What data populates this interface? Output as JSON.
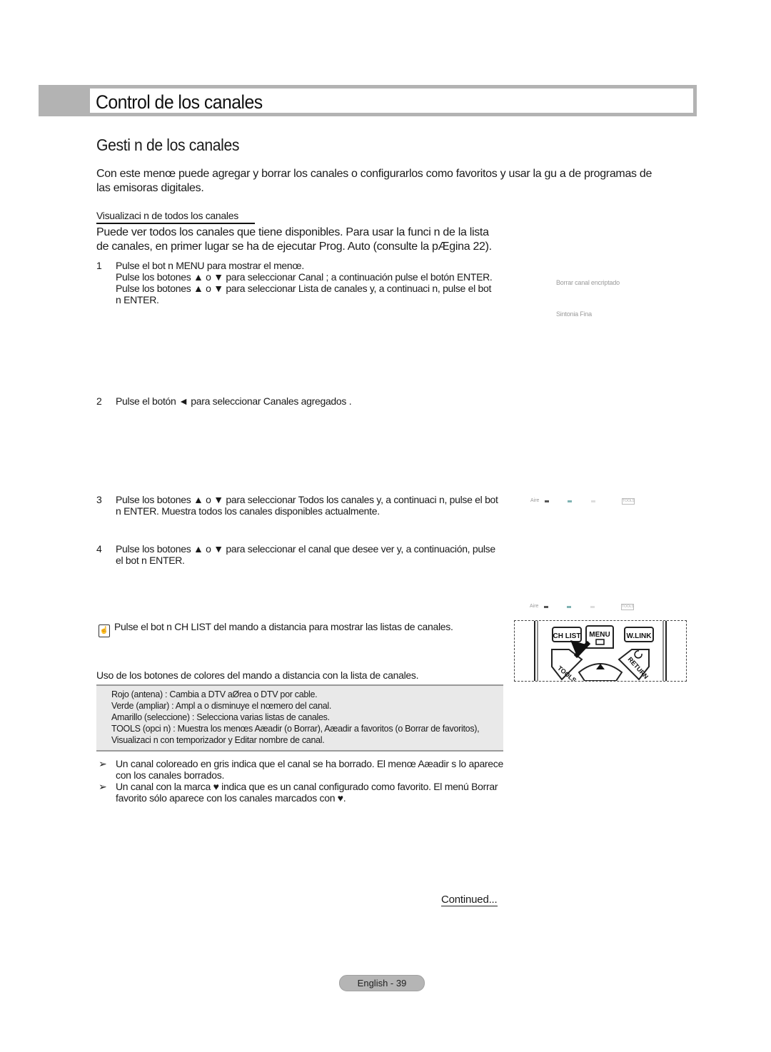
{
  "header": {
    "title": "Control de los canales"
  },
  "section": {
    "title": "Gesti n de los canales",
    "intro": "Con este menœ puede agregar y borrar los canales o configurarlos como favoritos y usar la gu a de programas de las emisoras digitales."
  },
  "subsection": {
    "heading": "Visualizaci n de todos los canales",
    "intro": "Puede ver todos los canales que tiene disponibles. Para usar la funci n de la lista de canales, en primer lugar se ha de ejecutar Prog. Auto (consulte la pÆgina 22)."
  },
  "steps": [
    {
      "number": "1",
      "lines": [
        "Pulse el bot n  MENU para mostrar el menœ.",
        "Pulse los botones ▲ o ▼ para seleccionar Canal ; a continuación pulse el botón ENTER.",
        "Pulse los botones ▲ o ▼ para seleccionar Lista de canales   y, a continuaci n, pulse el bot n  ENTER."
      ]
    },
    {
      "number": "2",
      "lines": [
        "Pulse el botón ◄ para seleccionar Canales agregados  ."
      ]
    },
    {
      "number": "3",
      "lines": [
        "Pulse los botones ▲ o ▼ para seleccionar Todos los canales    y, a continuaci n, pulse el bot n  ENTER. Muestra todos los canales disponibles actualmente."
      ]
    },
    {
      "number": "4",
      "lines": [
        "Pulse los botones ▲ o ▼ para seleccionar el canal que desee ver y, a continuación, pulse el bot n  ENTER."
      ]
    }
  ],
  "osd": {
    "menu_item_1": "Borrar canal encriptado",
    "menu_item_2": "Sintonia Fina",
    "legend_label": "Aire",
    "legend_tools": "TOOLS",
    "legend_colors": [
      "#555555",
      "#7fb3b3",
      "#dddddd"
    ]
  },
  "note": {
    "icon": "remote-hand-icon",
    "text": "Pulse el bot n  CH LIST del mando a distancia para mostrar las listas de canales."
  },
  "remote": {
    "buttons": [
      "CH LIST",
      "MENU",
      "W.LINK",
      "TOOLS",
      "RETURN"
    ]
  },
  "color_buttons": {
    "intro": "Uso de los botones de colores del mando a distancia con la lista de canales.",
    "lines": [
      "Rojo (antena) : Cambia a DTV aØrea o DTV por cable.",
      "Verde (ampliar) : Ampl a o disminuye el nœmero del canal.",
      "Amarillo (seleccione)   : Selecciona varias listas de canales.",
      "TOOLS (opci n)   : Muestra los menœs Aæadir (o Borrar), Aæadir a favoritos (o Borrar de favoritos),",
      "Visualizaci n con temporizador y Editar nombre de canal."
    ]
  },
  "tips": [
    {
      "arrow": "➢",
      "text": "Un canal coloreado en gris indica que el canal se ha borrado. El menœ Aæadir s lo aparece con los canales borrados."
    },
    {
      "arrow": "➢",
      "text": "Un canal con la marca ♥ indica que es un canal configurado como favorito. El menú Borrar favorito sólo aparece con los canales marcados con ♥."
    }
  ],
  "footer": {
    "continued": "Continued...",
    "page_label": "English - 39"
  }
}
